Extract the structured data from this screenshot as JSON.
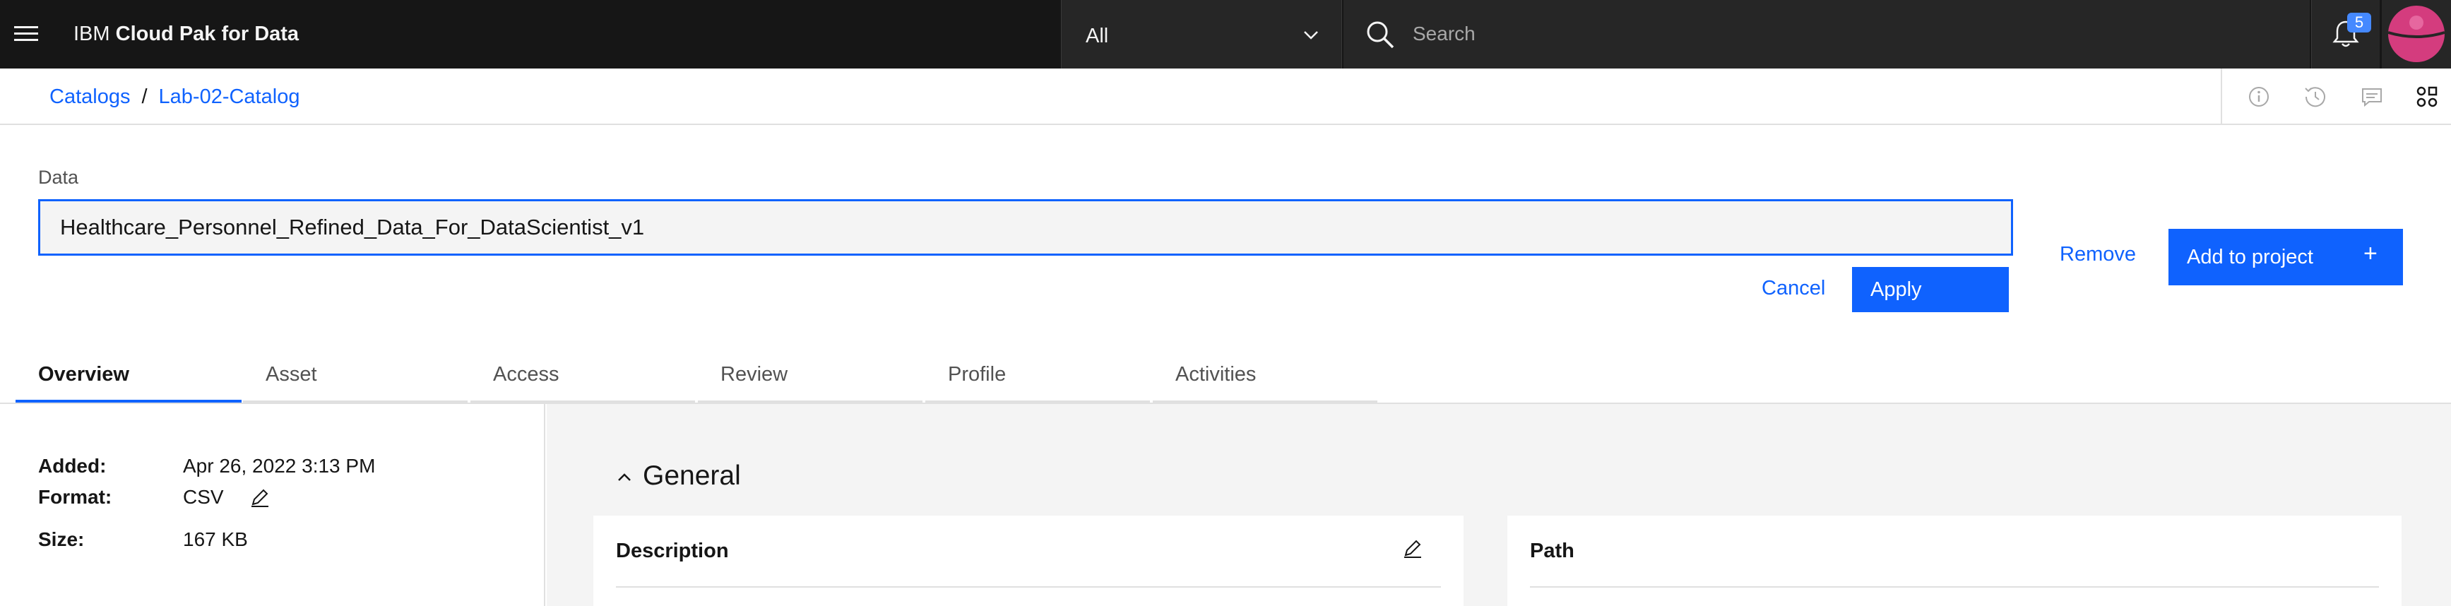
{
  "header": {
    "brand_prefix": "IBM",
    "brand_name": "Cloud Pak for Data",
    "scope_value": "All",
    "search_placeholder": "Search",
    "notification_count": "5"
  },
  "breadcrumb": {
    "items": [
      {
        "label": "Catalogs"
      },
      {
        "label": "Lab-02-Catalog"
      }
    ],
    "separator": "/"
  },
  "editor": {
    "field_label": "Data",
    "name_value": "Healthcare_Personnel_Refined_Data_For_DataScientist_v1",
    "cancel_label": "Cancel",
    "apply_label": "Apply",
    "remove_label": "Remove",
    "add_to_project_label": "Add to project",
    "add_icon": "+"
  },
  "tabs": [
    {
      "label": "Overview",
      "active": true
    },
    {
      "label": "Asset",
      "active": false
    },
    {
      "label": "Access",
      "active": false
    },
    {
      "label": "Review",
      "active": false
    },
    {
      "label": "Profile",
      "active": false
    },
    {
      "label": "Activities",
      "active": false
    }
  ],
  "details": {
    "added_key": "Added:",
    "added_value": "Apr 26, 2022 3:13 PM",
    "format_key": "Format:",
    "format_value": "CSV",
    "size_key": "Size:",
    "size_value": "167 KB"
  },
  "general": {
    "section_title": "General",
    "description_title": "Description",
    "path_title": "Path"
  },
  "colors": {
    "accent": "#0f62fe",
    "header_bg": "#161616",
    "avatar": "#d43c7e"
  },
  "icons": {
    "menu": "hamburger-icon",
    "scope": "chevron-down-icon",
    "search": "search-icon",
    "notifications": "bell-icon",
    "user": "avatar-icon",
    "tools": [
      "info-icon",
      "history-icon",
      "comment-icon",
      "relationships-icon"
    ],
    "edit": "pencil-icon",
    "collapse": "chevron-up-icon"
  }
}
